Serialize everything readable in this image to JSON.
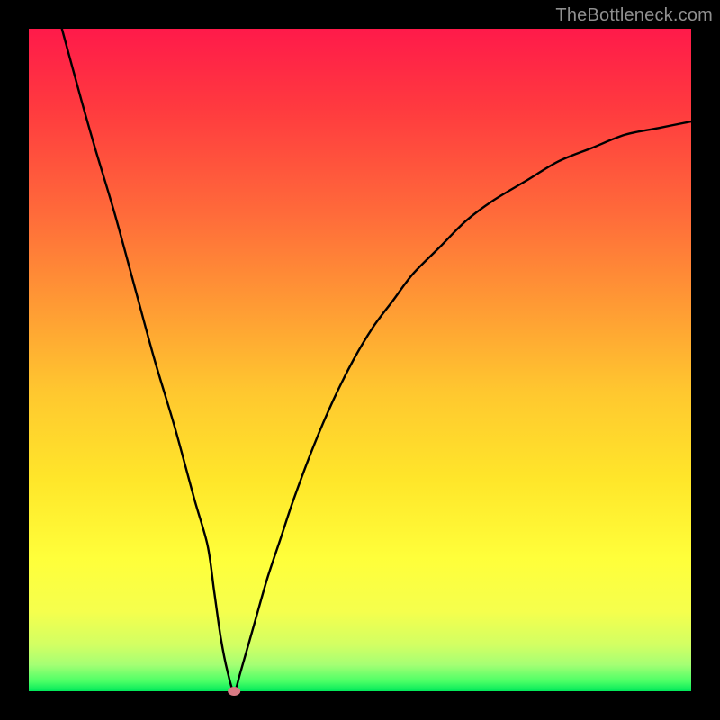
{
  "watermark": "TheBottleneck.com",
  "colors": {
    "frame": "#000000",
    "curve": "#000000",
    "dot": "#d97a84",
    "gradient_top": "#ff1a4a",
    "gradient_bottom": "#00e85a"
  },
  "chart_data": {
    "type": "line",
    "title": "",
    "xlabel": "",
    "ylabel": "",
    "xlim": [
      0,
      100
    ],
    "ylim": [
      0,
      100
    ],
    "grid": false,
    "legend": false,
    "axes_visible": false,
    "series": [
      {
        "name": "bottleneck-curve",
        "x": [
          5,
          8,
          10,
          13,
          16,
          19,
          22,
          25,
          27,
          28,
          29,
          30,
          31,
          32,
          34,
          36,
          38,
          40,
          43,
          46,
          49,
          52,
          55,
          58,
          62,
          66,
          70,
          75,
          80,
          85,
          90,
          95,
          100
        ],
        "y": [
          100,
          89,
          82,
          72,
          61,
          50,
          40,
          29,
          22,
          15,
          8,
          3,
          0,
          3,
          10,
          17,
          23,
          29,
          37,
          44,
          50,
          55,
          59,
          63,
          67,
          71,
          74,
          77,
          80,
          82,
          84,
          85,
          86
        ]
      }
    ],
    "marker": {
      "name": "optimal-point",
      "x": 31,
      "y": 0
    },
    "background_gradient": {
      "orientation": "vertical",
      "stops": [
        {
          "pos": 0.0,
          "color": "#ff1a4a"
        },
        {
          "pos": 0.12,
          "color": "#ff3a3f"
        },
        {
          "pos": 0.28,
          "color": "#ff6b3a"
        },
        {
          "pos": 0.42,
          "color": "#ff9b34"
        },
        {
          "pos": 0.55,
          "color": "#ffc82f"
        },
        {
          "pos": 0.68,
          "color": "#ffe62a"
        },
        {
          "pos": 0.8,
          "color": "#ffff3a"
        },
        {
          "pos": 0.88,
          "color": "#f5ff4d"
        },
        {
          "pos": 0.93,
          "color": "#d2ff63"
        },
        {
          "pos": 0.96,
          "color": "#a5ff74"
        },
        {
          "pos": 0.985,
          "color": "#4bff66"
        },
        {
          "pos": 1.0,
          "color": "#00e85a"
        }
      ]
    }
  }
}
